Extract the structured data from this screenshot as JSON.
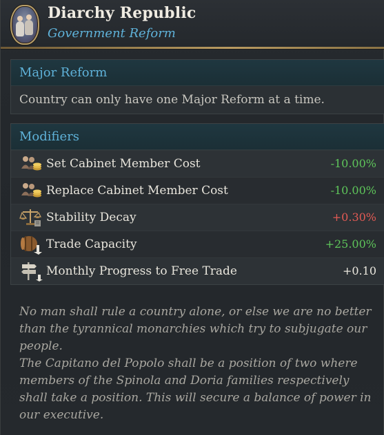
{
  "header": {
    "title": "Diarchy Republic",
    "subtitle": "Government Reform",
    "portrait_icon": "diarchy-portrait-icon"
  },
  "major_reform": {
    "heading": "Major Reform",
    "text": "Country can only have one Major Reform at a time."
  },
  "modifiers": {
    "heading": "Modifiers",
    "rows": [
      {
        "icon": "cabinet-cost-icon",
        "label": "Set Cabinet Member Cost",
        "value": "-10.00%",
        "tone": "good"
      },
      {
        "icon": "cabinet-cost-icon",
        "label": "Replace Cabinet Member Cost",
        "value": "-10.00%",
        "tone": "good"
      },
      {
        "icon": "stability-scales-icon",
        "label": "Stability Decay",
        "value": "+0.30%",
        "tone": "bad"
      },
      {
        "icon": "trade-barrel-icon",
        "label": "Trade Capacity",
        "value": "+25.00%",
        "tone": "good"
      },
      {
        "icon": "free-trade-signpost-icon",
        "label": "Monthly Progress to Free Trade",
        "value": "+0.10",
        "tone": "neutral"
      }
    ]
  },
  "flavor": {
    "paragraph1": "No man shall rule a country alone, or else we are no better than the tyrannical monarchies which try to subjugate our people.",
    "paragraph2": "The Capitano del Popolo shall be a position of two where members of the Spinola and Doria families respectively shall take a position. This will secure a balance of power in our executive."
  },
  "colors": {
    "accent_blue": "#5fb2d9",
    "good_green": "#5ec55a",
    "bad_red": "#e25a54",
    "gold_rule": "#a38853"
  }
}
